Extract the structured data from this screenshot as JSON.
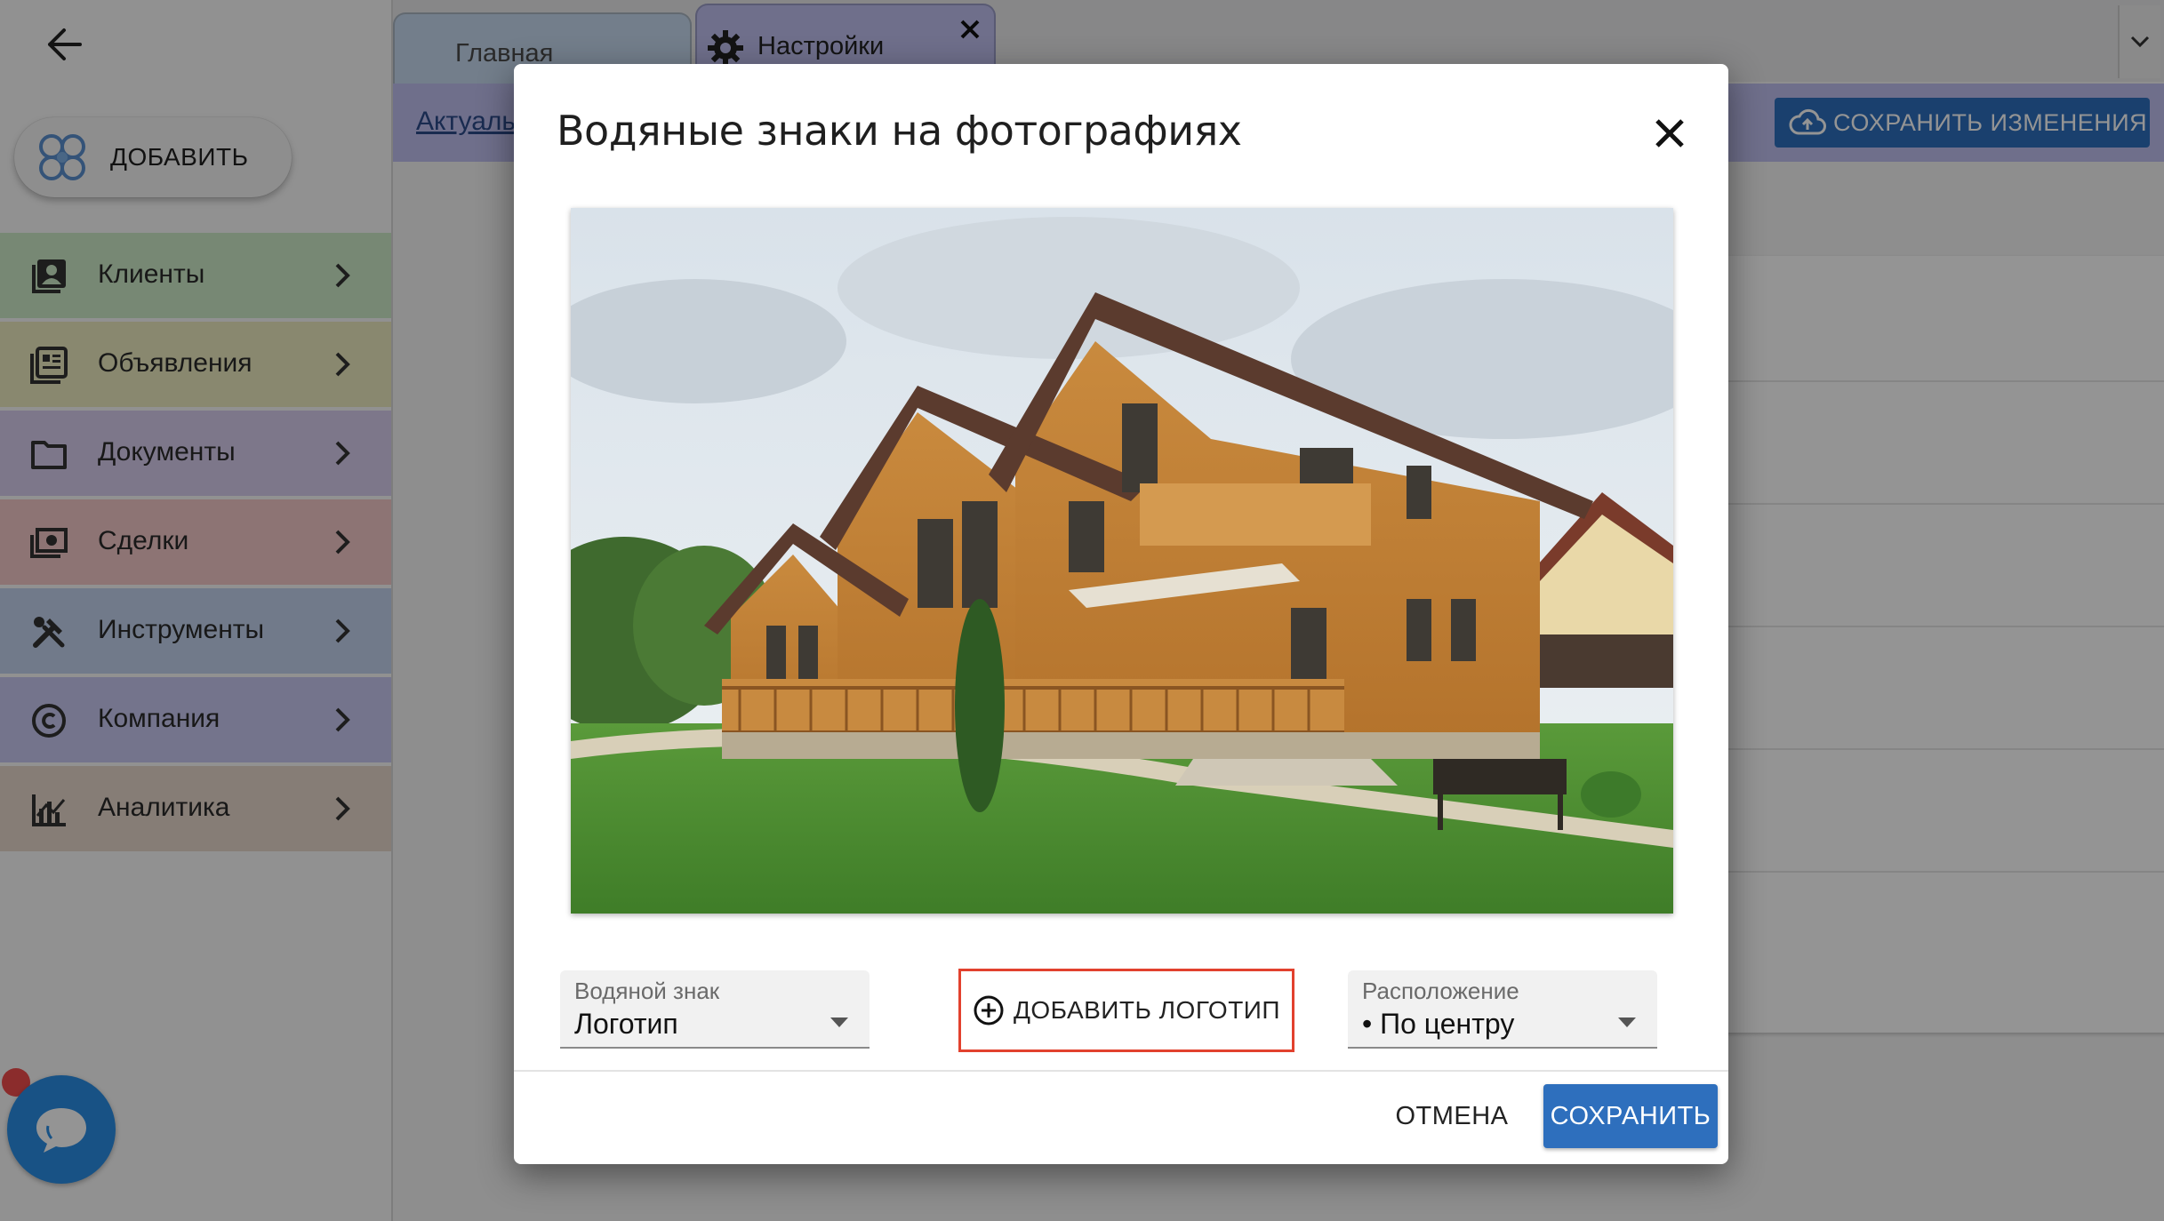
{
  "colors": {
    "accent": "#2e6fbd",
    "highlight_border": "#e2412e",
    "nav_clients": "#cdebc8",
    "nav_ads": "#ecebc0",
    "nav_documents": "#d8cdee",
    "nav_deals": "#f3c9c9",
    "nav_tools": "#c3d3ee",
    "nav_company": "#c8c9f1",
    "nav_analytics": "#e7d7cb"
  },
  "header": {
    "back_icon": "arrow-left-icon",
    "add_button_label": "ДОБАВИТЬ",
    "tabs": [
      {
        "label": "Главная"
      },
      {
        "label": "Настройки",
        "icon": "gear-icon"
      }
    ],
    "toolbar_link": "Актуаль",
    "save_changes_label": "СОХРАНИТЬ ИЗМЕНЕНИЯ"
  },
  "sidebar": {
    "items": [
      {
        "label": "Клиенты",
        "icon": "contacts-icon"
      },
      {
        "label": "Объявления",
        "icon": "ads-icon"
      },
      {
        "label": "Документы",
        "icon": "folder-icon"
      },
      {
        "label": "Сделки",
        "icon": "money-icon"
      },
      {
        "label": "Инструменты",
        "icon": "tools-icon"
      },
      {
        "label": "Компания",
        "icon": "copyright-icon"
      },
      {
        "label": "Аналитика",
        "icon": "analytics-icon"
      }
    ]
  },
  "modal": {
    "title": "Водяные знаки на фотографиях",
    "watermark_field": {
      "label": "Водяной знак",
      "value": "Логотип"
    },
    "add_logo_label": "ДОБАВИТЬ ЛОГОТИП",
    "position_field": {
      "label": "Расположение",
      "value": "• По центру"
    },
    "cancel_label": "ОТМЕНА",
    "save_label": "СОХРАНИТЬ"
  }
}
